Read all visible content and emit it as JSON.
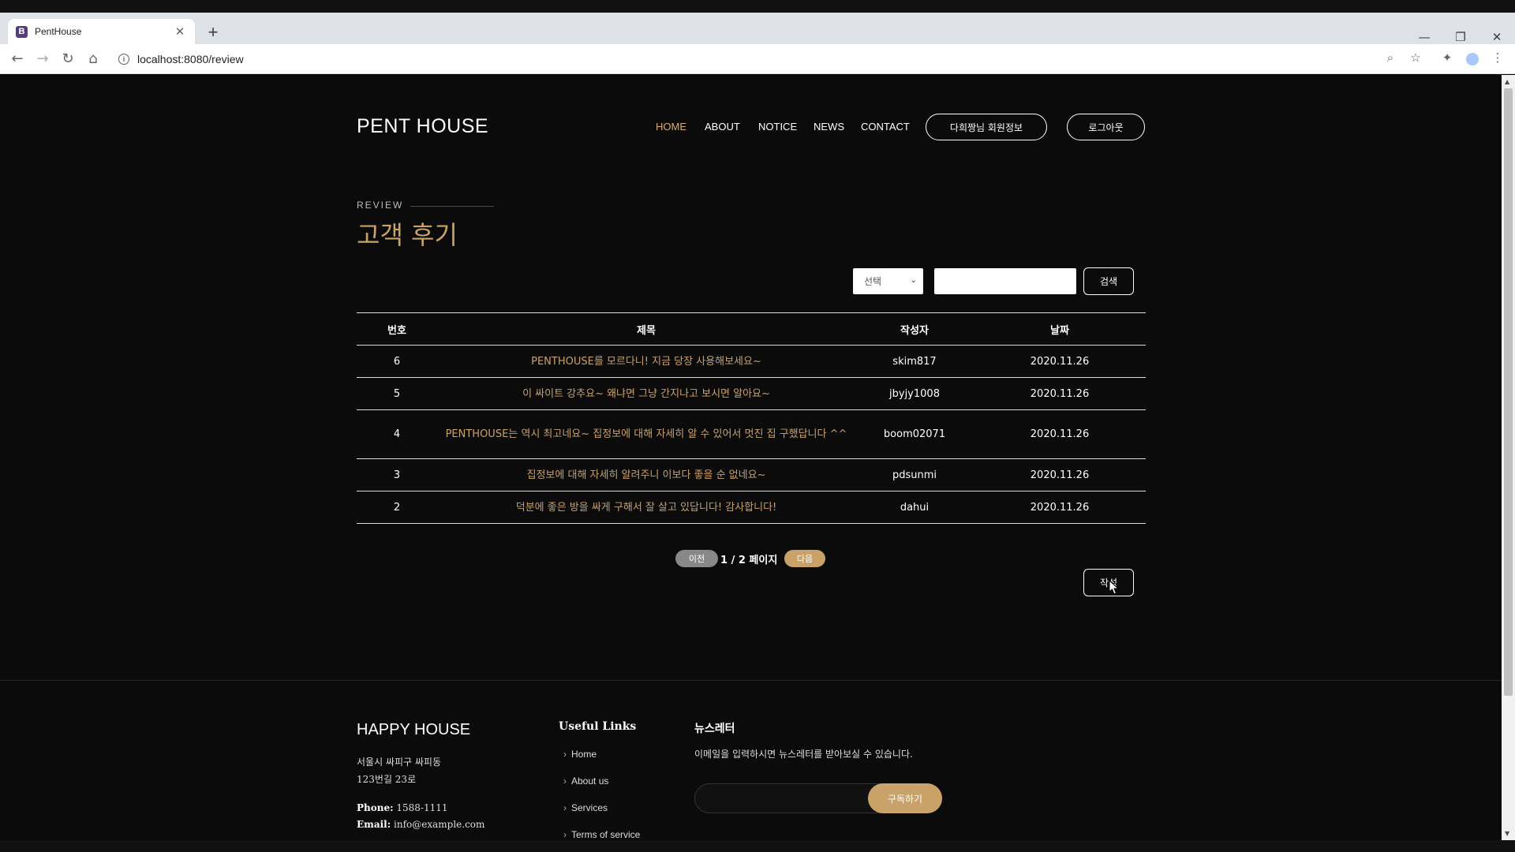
{
  "browser": {
    "tab_title": "PentHouse",
    "tab_favicon": "B",
    "url": "localhost:8080/review",
    "new_tab_glyph": "+",
    "close_glyph": "✕"
  },
  "header": {
    "brand": "PENT HOUSE",
    "nav": [
      "HOME",
      "ABOUT",
      "NOTICE",
      "NEWS",
      "CONTACT"
    ],
    "active_nav": "HOME",
    "member_info_button": "다희짱님 회원정보",
    "logout_button": "로그아웃"
  },
  "section": {
    "eyebrow": "REVIEW",
    "title": "고객 후기"
  },
  "search": {
    "select_value": "선택",
    "input_value": "",
    "button_label": "검색"
  },
  "table": {
    "headers": [
      "번호",
      "제목",
      "작성자",
      "날짜"
    ],
    "rows": [
      {
        "num": "6",
        "title": "PENTHOUSE를 모르다니! 지금 당장 사용해보세요~",
        "writer": "skim817",
        "date": "2020.11.26"
      },
      {
        "num": "5",
        "title": "이 싸이트 강추요~ 왜냐면 그냥 간지나고 보시면 알아요~",
        "writer": "jbyjy1008",
        "date": "2020.11.26"
      },
      {
        "num": "4",
        "title": "PENTHOUSE는 역시 최고네요~ 집정보에 대해 자세히 알 수 있어서 멋진 집 구했답니다 ^^",
        "writer": "boom02071",
        "date": "2020.11.26"
      },
      {
        "num": "3",
        "title": "집정보에 대해 자세히 알려주니 이보다 좋을 순 없네요~",
        "writer": "pdsunmi",
        "date": "2020.11.26"
      },
      {
        "num": "2",
        "title": "덕분에 좋은 방을 싸게 구해서 잘 살고 있답니다! 감사합니다!",
        "writer": "dahui",
        "date": "2020.11.26"
      }
    ]
  },
  "pagination": {
    "prev_label": "이전",
    "page_info": "1 / 2 페이지",
    "next_label": "다음"
  },
  "write_button": "작성",
  "footer": {
    "brand": "HAPPY HOUSE",
    "address_line1": "서울시 싸피구 싸피동",
    "address_line2": "123번길 23로",
    "phone_label": "Phone:",
    "phone": "1588-1111",
    "email_label": "Email:",
    "email": "info@example.com",
    "links_heading": "Useful Links",
    "links": [
      "Home",
      "About us",
      "Services",
      "Terms of service"
    ],
    "newsletter_heading": "뉴스레터",
    "newsletter_desc": "이메일을 입력하시면 뉴스레터를 받아보실 수 있습니다.",
    "subscribe_label": "구독하기"
  },
  "colors": {
    "accent": "#c9a26a",
    "background": "#0b0b0b",
    "text": "#ffffff"
  }
}
